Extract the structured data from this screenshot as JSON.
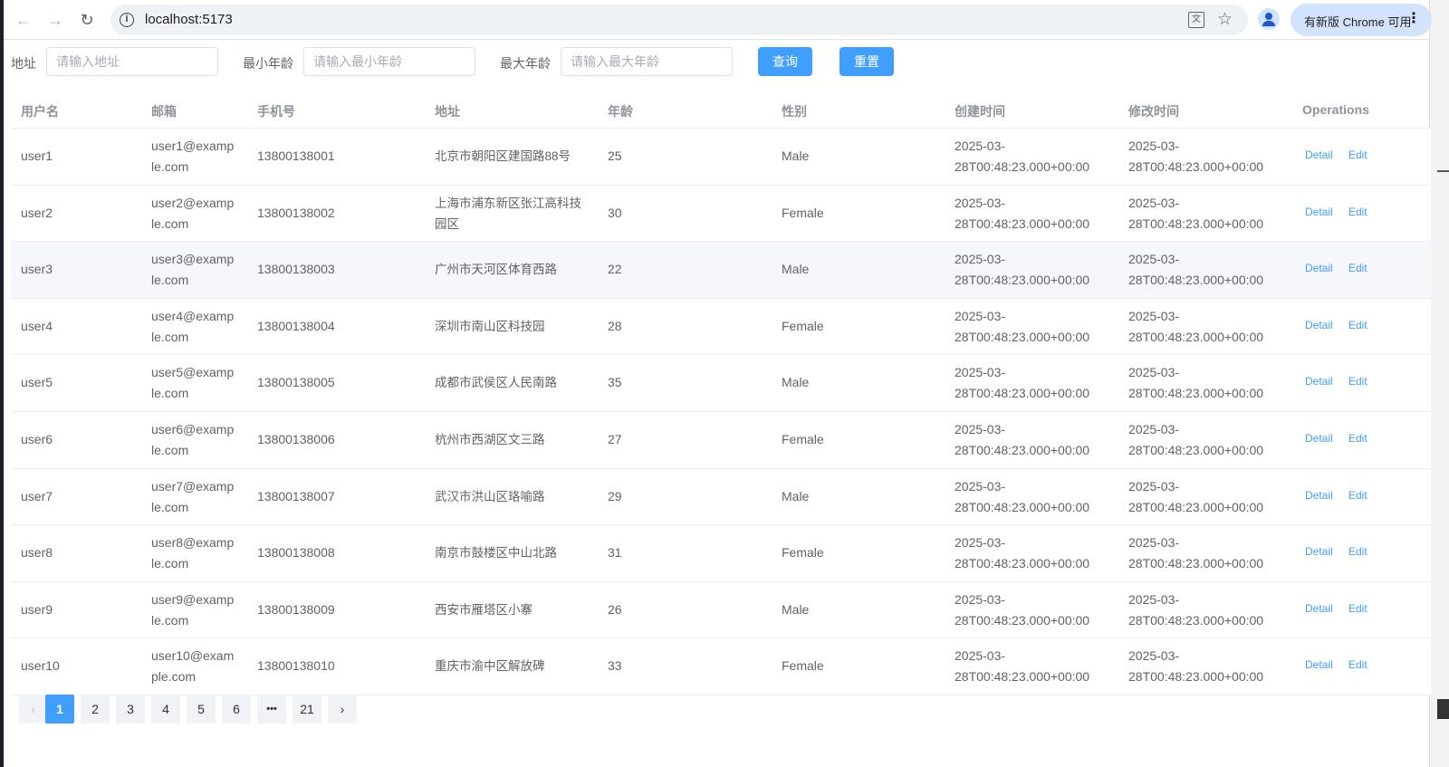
{
  "browser": {
    "url": "localhost:5173",
    "update_label": "有新版 Chrome 可用"
  },
  "search": {
    "address_label": "地址",
    "address_placeholder": "请输入地址",
    "min_age_label": "最小年龄",
    "min_age_placeholder": "请输入最小年龄",
    "max_age_label": "最大年龄",
    "max_age_placeholder": "请输入最大年龄",
    "query_label": "查询",
    "reset_label": "重置"
  },
  "table": {
    "headers": [
      "用户名",
      "邮箱",
      "手机号",
      "地址",
      "年龄",
      "性别",
      "创建时间",
      "修改时间",
      "Operations"
    ],
    "detail_label": "Detail",
    "edit_label": "Edit",
    "rows": [
      {
        "username": "user1",
        "email1": "user1@examp",
        "email2": "le.com",
        "phone": "13800138001",
        "addr1": "北京市朝阳区建国路88号",
        "addr2": "",
        "age": "25",
        "gender": "Male",
        "created1": "2025-03-",
        "created2": "28T00:48:23.000+00:00",
        "modified1": "2025-03-",
        "modified2": "28T00:48:23.000+00:00"
      },
      {
        "username": "user2",
        "email1": "user2@examp",
        "email2": "le.com",
        "phone": "13800138002",
        "addr1": "上海市浦东新区张江高科技",
        "addr2": "园区",
        "age": "30",
        "gender": "Female",
        "created1": "2025-03-",
        "created2": "28T00:48:23.000+00:00",
        "modified1": "2025-03-",
        "modified2": "28T00:48:23.000+00:00"
      },
      {
        "username": "user3",
        "email1": "user3@examp",
        "email2": "le.com",
        "phone": "13800138003",
        "addr1": "广州市天河区体育西路",
        "addr2": "",
        "age": "22",
        "gender": "Male",
        "created1": "2025-03-",
        "created2": "28T00:48:23.000+00:00",
        "modified1": "2025-03-",
        "modified2": "28T00:48:23.000+00:00"
      },
      {
        "username": "user4",
        "email1": "user4@examp",
        "email2": "le.com",
        "phone": "13800138004",
        "addr1": "深圳市南山区科技园",
        "addr2": "",
        "age": "28",
        "gender": "Female",
        "created1": "2025-03-",
        "created2": "28T00:48:23.000+00:00",
        "modified1": "2025-03-",
        "modified2": "28T00:48:23.000+00:00"
      },
      {
        "username": "user5",
        "email1": "user5@examp",
        "email2": "le.com",
        "phone": "13800138005",
        "addr1": "成都市武侯区人民南路",
        "addr2": "",
        "age": "35",
        "gender": "Male",
        "created1": "2025-03-",
        "created2": "28T00:48:23.000+00:00",
        "modified1": "2025-03-",
        "modified2": "28T00:48:23.000+00:00"
      },
      {
        "username": "user6",
        "email1": "user6@examp",
        "email2": "le.com",
        "phone": "13800138006",
        "addr1": "杭州市西湖区文三路",
        "addr2": "",
        "age": "27",
        "gender": "Female",
        "created1": "2025-03-",
        "created2": "28T00:48:23.000+00:00",
        "modified1": "2025-03-",
        "modified2": "28T00:48:23.000+00:00"
      },
      {
        "username": "user7",
        "email1": "user7@examp",
        "email2": "le.com",
        "phone": "13800138007",
        "addr1": "武汉市洪山区珞喻路",
        "addr2": "",
        "age": "29",
        "gender": "Male",
        "created1": "2025-03-",
        "created2": "28T00:48:23.000+00:00",
        "modified1": "2025-03-",
        "modified2": "28T00:48:23.000+00:00"
      },
      {
        "username": "user8",
        "email1": "user8@examp",
        "email2": "le.com",
        "phone": "13800138008",
        "addr1": "南京市鼓楼区中山北路",
        "addr2": "",
        "age": "31",
        "gender": "Female",
        "created1": "2025-03-",
        "created2": "28T00:48:23.000+00:00",
        "modified1": "2025-03-",
        "modified2": "28T00:48:23.000+00:00"
      },
      {
        "username": "user9",
        "email1": "user9@examp",
        "email2": "le.com",
        "phone": "13800138009",
        "addr1": "西安市雁塔区小寨",
        "addr2": "",
        "age": "26",
        "gender": "Male",
        "created1": "2025-03-",
        "created2": "28T00:48:23.000+00:00",
        "modified1": "2025-03-",
        "modified2": "28T00:48:23.000+00:00"
      },
      {
        "username": "user10",
        "email1": "user10@exam",
        "email2": "ple.com",
        "phone": "13800138010",
        "addr1": "重庆市渝中区解放碑",
        "addr2": "",
        "age": "33",
        "gender": "Female",
        "created1": "2025-03-",
        "created2": "28T00:48:23.000+00:00",
        "modified1": "2025-03-",
        "modified2": "28T00:48:23.000+00:00"
      }
    ]
  },
  "pagination": {
    "prev": "‹",
    "pages": [
      "1",
      "2",
      "3",
      "4",
      "5",
      "6"
    ],
    "more": "•••",
    "last": "21",
    "next": "›",
    "current": "1"
  },
  "colors": {
    "primary": "#409eff",
    "header_text": "#909399",
    "body_text": "#606266",
    "border": "#ebeef5"
  }
}
